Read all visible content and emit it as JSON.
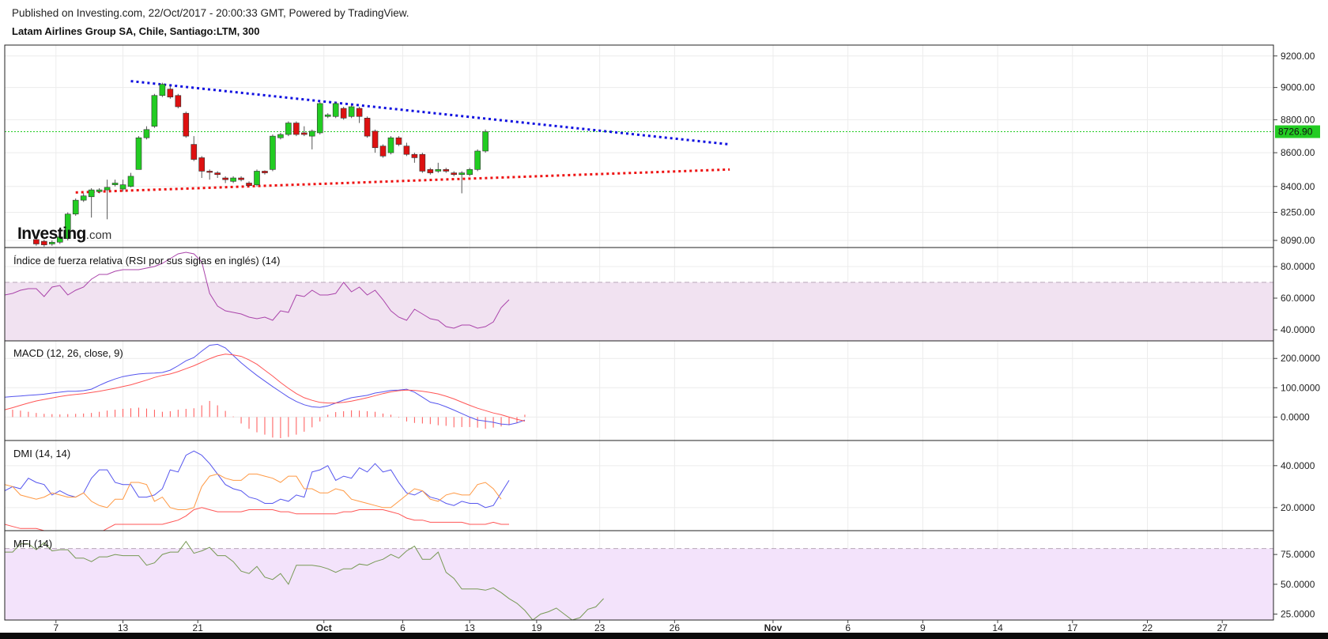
{
  "header": {
    "published": "Published on Investing.com, 22/Oct/2017 - 20:00:33 GMT, Powered by TradingView.",
    "symbol": "Latam Airlines Group SA, Chile, Santiago:LTM, 300"
  },
  "watermark": {
    "brand": "Investing",
    "suffix": ".com"
  },
  "colors": {
    "up": "#22cc22",
    "down": "#dd1111",
    "wick": "#555555",
    "resistance": "#1010e0",
    "support": "#ee1111",
    "price_line": "#22cc22",
    "rsi": "#aa44aa",
    "rsi_band": "#f1e2f1",
    "macd": "#5555ee",
    "signal": "#ff5555",
    "dmi_plus": "#5555ee",
    "dmi_minus": "#ff5555",
    "adx": "#ff9944",
    "mfi": "#779955",
    "mfi_band": "#f3e3fb"
  },
  "chart_data": [
    {
      "type": "candlestick",
      "name": "price",
      "ylim": [
        8050,
        9270
      ],
      "y_scale": "log",
      "y_ticks": [
        "9200.00",
        "9000.00",
        "8800.00",
        "8600.00",
        "8400.00",
        "8250.00",
        "8090.00"
      ],
      "y_tick_values": [
        9200,
        9000,
        8800,
        8600,
        8400,
        8250,
        8090
      ],
      "last_price": 8726.9,
      "last_price_label": "8726.90",
      "grid": true,
      "candles": [
        {
          "x": 4,
          "o": 8095,
          "c": 8070,
          "h": 8100,
          "l": 8060
        },
        {
          "x": 5,
          "o": 8085,
          "c": 8065,
          "h": 8095,
          "l": 8055
        },
        {
          "x": 6,
          "o": 8070,
          "c": 8080,
          "h": 8090,
          "l": 8060
        },
        {
          "x": 7,
          "o": 8080,
          "c": 8110,
          "h": 8120,
          "l": 8070
        },
        {
          "x": 8,
          "o": 8100,
          "c": 8240,
          "h": 8250,
          "l": 8090
        },
        {
          "x": 9,
          "o": 8240,
          "c": 8320,
          "h": 8330,
          "l": 8230
        },
        {
          "x": 10,
          "o": 8320,
          "c": 8345,
          "h": 8360,
          "l": 8310
        },
        {
          "x": 11,
          "o": 8340,
          "c": 8380,
          "h": 8390,
          "l": 8220
        },
        {
          "x": 12,
          "o": 8370,
          "c": 8380,
          "h": 8390,
          "l": 8360
        },
        {
          "x": 13,
          "o": 8380,
          "c": 8395,
          "h": 8440,
          "l": 8210
        },
        {
          "x": 14,
          "o": 8410,
          "c": 8420,
          "h": 8440,
          "l": 8400
        },
        {
          "x": 15,
          "o": 8385,
          "c": 8410,
          "h": 8440,
          "l": 8370
        },
        {
          "x": 16,
          "o": 8400,
          "c": 8460,
          "h": 8480,
          "l": 8395
        },
        {
          "x": 17,
          "o": 8500,
          "c": 8690,
          "h": 8700,
          "l": 8500
        },
        {
          "x": 18,
          "o": 8690,
          "c": 8740,
          "h": 8760,
          "l": 8680
        },
        {
          "x": 19,
          "o": 8760,
          "c": 8950,
          "h": 8960,
          "l": 8750
        },
        {
          "x": 20,
          "o": 8950,
          "c": 9020,
          "h": 9030,
          "l": 8940
        },
        {
          "x": 21,
          "o": 8990,
          "c": 8940,
          "h": 9010,
          "l": 8930
        },
        {
          "x": 22,
          "o": 8950,
          "c": 8880,
          "h": 8960,
          "l": 8870
        },
        {
          "x": 23,
          "o": 8840,
          "c": 8700,
          "h": 8850,
          "l": 8690
        },
        {
          "x": 24,
          "o": 8650,
          "c": 8560,
          "h": 8700,
          "l": 8550
        },
        {
          "x": 25,
          "o": 8570,
          "c": 8490,
          "h": 8580,
          "l": 8450
        },
        {
          "x": 26,
          "o": 8490,
          "c": 8485,
          "h": 8500,
          "l": 8440
        },
        {
          "x": 27,
          "o": 8480,
          "c": 8470,
          "h": 8490,
          "l": 8450
        },
        {
          "x": 28,
          "o": 8450,
          "c": 8440,
          "h": 8460,
          "l": 8420
        },
        {
          "x": 29,
          "o": 8430,
          "c": 8450,
          "h": 8460,
          "l": 8420
        },
        {
          "x": 30,
          "o": 8450,
          "c": 8440,
          "h": 8460,
          "l": 8430
        },
        {
          "x": 31,
          "o": 8420,
          "c": 8405,
          "h": 8430,
          "l": 8400
        },
        {
          "x": 32,
          "o": 8410,
          "c": 8490,
          "h": 8500,
          "l": 8400
        },
        {
          "x": 33,
          "o": 8490,
          "c": 8480,
          "h": 8495,
          "l": 8470
        },
        {
          "x": 34,
          "o": 8500,
          "c": 8700,
          "h": 8710,
          "l": 8490
        },
        {
          "x": 35,
          "o": 8690,
          "c": 8710,
          "h": 8720,
          "l": 8680
        },
        {
          "x": 36,
          "o": 8710,
          "c": 8780,
          "h": 8790,
          "l": 8700
        },
        {
          "x": 37,
          "o": 8780,
          "c": 8710,
          "h": 8790,
          "l": 8700
        },
        {
          "x": 38,
          "o": 8720,
          "c": 8710,
          "h": 8760,
          "l": 8700
        },
        {
          "x": 39,
          "o": 8700,
          "c": 8730,
          "h": 8740,
          "l": 8620
        },
        {
          "x": 40,
          "o": 8720,
          "c": 8900,
          "h": 8910,
          "l": 8710
        },
        {
          "x": 41,
          "o": 8820,
          "c": 8830,
          "h": 8840,
          "l": 8810
        },
        {
          "x": 42,
          "o": 8820,
          "c": 8900,
          "h": 8910,
          "l": 8810
        },
        {
          "x": 43,
          "o": 8870,
          "c": 8810,
          "h": 8880,
          "l": 8800
        },
        {
          "x": 44,
          "o": 8820,
          "c": 8880,
          "h": 8890,
          "l": 8810
        },
        {
          "x": 45,
          "o": 8870,
          "c": 8820,
          "h": 8880,
          "l": 8780
        },
        {
          "x": 46,
          "o": 8810,
          "c": 8700,
          "h": 8820,
          "l": 8690
        },
        {
          "x": 47,
          "o": 8730,
          "c": 8630,
          "h": 8740,
          "l": 8600
        },
        {
          "x": 48,
          "o": 8640,
          "c": 8580,
          "h": 8650,
          "l": 8570
        },
        {
          "x": 49,
          "o": 8600,
          "c": 8690,
          "h": 8700,
          "l": 8590
        },
        {
          "x": 50,
          "o": 8690,
          "c": 8650,
          "h": 8700,
          "l": 8640
        },
        {
          "x": 51,
          "o": 8640,
          "c": 8590,
          "h": 8660,
          "l": 8580
        },
        {
          "x": 52,
          "o": 8590,
          "c": 8570,
          "h": 8600,
          "l": 8540
        },
        {
          "x": 53,
          "o": 8590,
          "c": 8490,
          "h": 8600,
          "l": 8480
        },
        {
          "x": 54,
          "o": 8500,
          "c": 8480,
          "h": 8510,
          "l": 8470
        },
        {
          "x": 55,
          "o": 8490,
          "c": 8500,
          "h": 8540,
          "l": 8480
        },
        {
          "x": 56,
          "o": 8500,
          "c": 8490,
          "h": 8510,
          "l": 8480
        },
        {
          "x": 57,
          "o": 8480,
          "c": 8470,
          "h": 8490,
          "l": 8460
        },
        {
          "x": 58,
          "o": 8470,
          "c": 8480,
          "h": 8490,
          "l": 8360
        },
        {
          "x": 59,
          "o": 8470,
          "c": 8500,
          "h": 8510,
          "l": 8460
        },
        {
          "x": 60,
          "o": 8500,
          "c": 8610,
          "h": 8620,
          "l": 8490
        },
        {
          "x": 61,
          "o": 8610,
          "c": 8727,
          "h": 8740,
          "l": 8600
        }
      ],
      "trendlines": [
        {
          "name": "resistance",
          "x1": 16,
          "y1": 9040,
          "x2": 92,
          "y2": 8650
        },
        {
          "name": "support",
          "x1": 9,
          "y1": 8365,
          "x2": 92,
          "y2": 8500
        }
      ]
    },
    {
      "type": "line",
      "name": "rsi",
      "title": "Índice de fuerza relativa (RSI por sus siglas en inglés) (14)",
      "ylim": [
        33,
        92
      ],
      "y_ticks": [
        "80.0000",
        "60.0000",
        "40.0000"
      ],
      "y_tick_values": [
        80,
        60,
        40
      ],
      "band": [
        30,
        70
      ],
      "series": [
        {
          "values": [
            62,
            63,
            65,
            66,
            66,
            61,
            67,
            68,
            62,
            65,
            67,
            72,
            75,
            75,
            77,
            78,
            78,
            78,
            79,
            80,
            82,
            85,
            88,
            89,
            88,
            83,
            63,
            55,
            52,
            51,
            50,
            48,
            47,
            48,
            46,
            52,
            51,
            62,
            61,
            65,
            62,
            62,
            63,
            70,
            64,
            67,
            62,
            65,
            59,
            52,
            48,
            46,
            53,
            50,
            47,
            46,
            42,
            41,
            43,
            43,
            41,
            42,
            45,
            54,
            59
          ]
        }
      ]
    },
    {
      "type": "line",
      "name": "macd",
      "title": "MACD (12, 26, close, 9)",
      "ylim": [
        -80,
        260
      ],
      "y_ticks": [
        "200.0000",
        "100.0000",
        "0.0000"
      ],
      "y_tick_values": [
        200,
        100,
        0
      ],
      "series": [
        {
          "name": "macd",
          "values": [
            68,
            70,
            72,
            74,
            76,
            78,
            82,
            85,
            88,
            88,
            90,
            95,
            108,
            120,
            130,
            138,
            143,
            147,
            149,
            150,
            152,
            160,
            175,
            192,
            203,
            225,
            245,
            248,
            236,
            210,
            185,
            163,
            142,
            123,
            104,
            86,
            68,
            53,
            42,
            35,
            33,
            38,
            48,
            58,
            66,
            70,
            74,
            82,
            86,
            91,
            92,
            95,
            85,
            68,
            51,
            45,
            35,
            24,
            12,
            0,
            -10,
            -14,
            -18,
            -24,
            -26,
            -20,
            -10
          ]
        },
        {
          "name": "signal",
          "values": [
            25,
            32,
            40,
            48,
            55,
            60,
            65,
            70,
            74,
            77,
            80,
            84,
            88,
            93,
            98,
            104,
            110,
            118,
            126,
            135,
            142,
            147,
            155,
            165,
            175,
            187,
            199,
            209,
            215,
            212,
            207,
            195,
            180,
            160,
            140,
            118,
            98,
            80,
            66,
            57,
            50,
            48,
            48,
            50,
            54,
            60,
            66,
            73,
            80,
            86,
            90,
            92,
            91,
            88,
            84,
            79,
            71,
            62,
            51,
            40,
            30,
            22,
            14,
            8,
            0,
            -8,
            -14
          ]
        }
      ],
      "histogram": [
        27,
        25,
        22,
        18,
        14,
        11,
        10,
        9,
        10,
        11,
        12,
        14,
        18,
        22,
        25,
        28,
        30,
        32,
        29,
        25,
        18,
        20,
        25,
        28,
        30,
        40,
        55,
        40,
        21,
        2,
        -22,
        -40,
        -52,
        -60,
        -70,
        -72,
        -68,
        -60,
        -50,
        -35,
        -15,
        8,
        17,
        20,
        23,
        22,
        20,
        18,
        12,
        8,
        -2,
        -15,
        -20,
        -22,
        -24,
        -28,
        -30,
        -35,
        -34,
        -34,
        -36,
        -40,
        -36,
        -32,
        -28,
        -20,
        8
      ]
    },
    {
      "type": "line",
      "name": "dmi",
      "title": "DMI (14, 14)",
      "ylim": [
        9,
        52
      ],
      "y_ticks": [
        "40.0000",
        "20.0000"
      ],
      "y_tick_values": [
        40,
        20
      ],
      "series": [
        {
          "name": "plus",
          "values": [
            28,
            30,
            29,
            34,
            32,
            31,
            26,
            28,
            26,
            25,
            27,
            34,
            38,
            38,
            32,
            31,
            31,
            25,
            25,
            26,
            29,
            38,
            37,
            45,
            47,
            45,
            41,
            36,
            31,
            29,
            28,
            25,
            24,
            22,
            22,
            24,
            23,
            26,
            25,
            37,
            38,
            40,
            33,
            35,
            34,
            39,
            37,
            41,
            37,
            38,
            32,
            27,
            26,
            28,
            25,
            24,
            22,
            21,
            23,
            22,
            22,
            20,
            21,
            27,
            33
          ]
        },
        {
          "name": "minus",
          "values": [
            12,
            11,
            10,
            10,
            10,
            9,
            8,
            8,
            8,
            8,
            8,
            8,
            8,
            10,
            12,
            12,
            12,
            12,
            12,
            12,
            12,
            13,
            14,
            16,
            19,
            20,
            19,
            18,
            18,
            18,
            18,
            19,
            19,
            19,
            19,
            18,
            18,
            17,
            17,
            17,
            17,
            17,
            17,
            18,
            18,
            19,
            19,
            19,
            19,
            18,
            17,
            15,
            14,
            14,
            13,
            13,
            13,
            13,
            13,
            12,
            12,
            12,
            13,
            12,
            12
          ]
        },
        {
          "name": "adx",
          "values": [
            31,
            30,
            26,
            25,
            24,
            25,
            27,
            26,
            25,
            25,
            27,
            23,
            21,
            20,
            24,
            24,
            32,
            32,
            31,
            23,
            25,
            20,
            19,
            19,
            20,
            30,
            35,
            36,
            34,
            33,
            33,
            36,
            36,
            35,
            34,
            32,
            35,
            35,
            29,
            29,
            27,
            27,
            29,
            28,
            24,
            23,
            22,
            21,
            20,
            20,
            23,
            26,
            29,
            28,
            24,
            23,
            26,
            27,
            26,
            26,
            31,
            32,
            29,
            24
          ]
        }
      ]
    },
    {
      "type": "line",
      "name": "mfi",
      "title": "MFI (14)",
      "ylim": [
        20,
        95
      ],
      "y_ticks": [
        "75.0000",
        "50.0000",
        "25.0000"
      ],
      "y_tick_values": [
        75,
        50,
        25
      ],
      "band": [
        20,
        80
      ],
      "series": [
        {
          "values": [
            77,
            77,
            84,
            84,
            79,
            85,
            78,
            79,
            79,
            72,
            72,
            69,
            73,
            73,
            75,
            74,
            74,
            74,
            66,
            68,
            75,
            77,
            77,
            86,
            76,
            78,
            81,
            74,
            74,
            69,
            61,
            59,
            65,
            56,
            54,
            59,
            50,
            66,
            66,
            66,
            65,
            63,
            60,
            63,
            63,
            67,
            66,
            69,
            71,
            75,
            72,
            78,
            82,
            71,
            71,
            77,
            60,
            55,
            46,
            46,
            46,
            45,
            47,
            43,
            38,
            34,
            28,
            20,
            25,
            27,
            30,
            25,
            20,
            22,
            29,
            31,
            38
          ]
        }
      ]
    }
  ],
  "x_axis": {
    "labels": [
      "7",
      "13",
      "21",
      "Oct",
      "6",
      "13",
      "19",
      "23",
      "26",
      "Nov",
      "6",
      "9",
      "14",
      "17",
      "22",
      "27"
    ],
    "positions": [
      6.5,
      15,
      24.5,
      40.5,
      50.5,
      59,
      67.5,
      75.5,
      85,
      97.5,
      107,
      116.5,
      126,
      135.5,
      145,
      154.5
    ],
    "bold": [
      "Oct",
      "Nov"
    ],
    "range": [
      0,
      161
    ]
  }
}
